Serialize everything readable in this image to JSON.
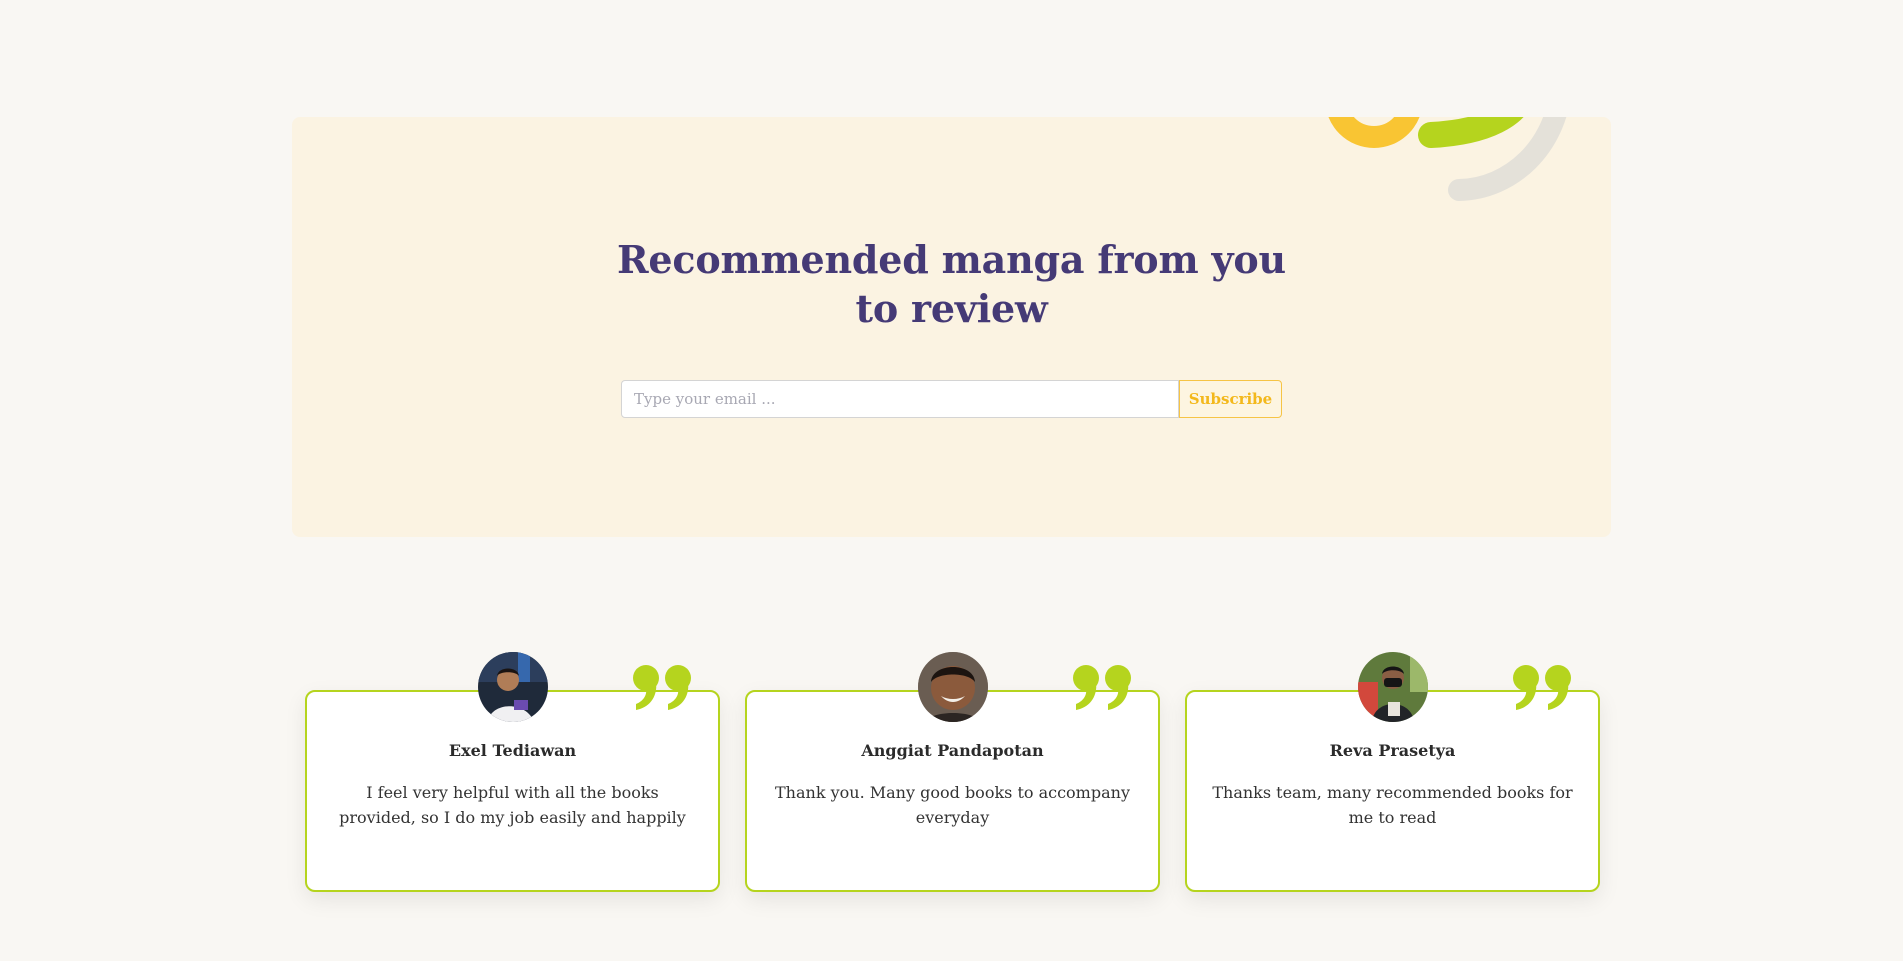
{
  "newsletter": {
    "headline": "Recommended manga from you to review",
    "email_placeholder": "Type your email ...",
    "subscribe_label": "Subscribe"
  },
  "testimonials": [
    {
      "name": "Exel Tediawan",
      "text": "I feel very helpful with all the books provided, so I do my job easily and happily"
    },
    {
      "name": "Anggiat Pandapotan",
      "text": "Thank you. Many good books to accompany everyday"
    },
    {
      "name": "Reva Prasetya",
      "text": "Thanks team, many recommended books for me to read"
    }
  ],
  "colors": {
    "page_background": "#f9f7f3",
    "panel_background": "#fbf3e2",
    "headline": "#453a76",
    "accent_green": "#b5d41e",
    "accent_yellow": "#f6c445",
    "decor_gray": "#e4e1d9"
  },
  "icons": {
    "quote": "quote-icon",
    "avatar": "avatar-photo"
  }
}
